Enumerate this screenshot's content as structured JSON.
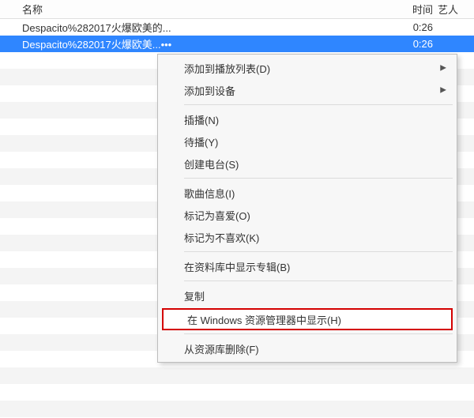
{
  "header": {
    "name": "名称",
    "time": "时间",
    "artist": "艺人"
  },
  "rows": [
    {
      "name": "Despacito%282017火爆欧美的...",
      "time": "0:26",
      "artist": ""
    },
    {
      "name": "Despacito%282017火爆欧美...•••",
      "time": "0:26",
      "artist": ""
    }
  ],
  "menu": {
    "add_playlist": "添加到播放列表(D)",
    "add_device": "添加到设备",
    "insert": "插播(N)",
    "queue_next": "待播(Y)",
    "create_station": "创建电台(S)",
    "song_info": "歌曲信息(I)",
    "love": "标记为喜爱(O)",
    "dislike": "标记为不喜欢(K)",
    "show_in_library": "在资料库中显示专辑(B)",
    "copy": "复制",
    "show_in_explorer": "在 Windows 资源管理器中显示(H)",
    "delete_from_library": "从资源库删除(F)"
  }
}
